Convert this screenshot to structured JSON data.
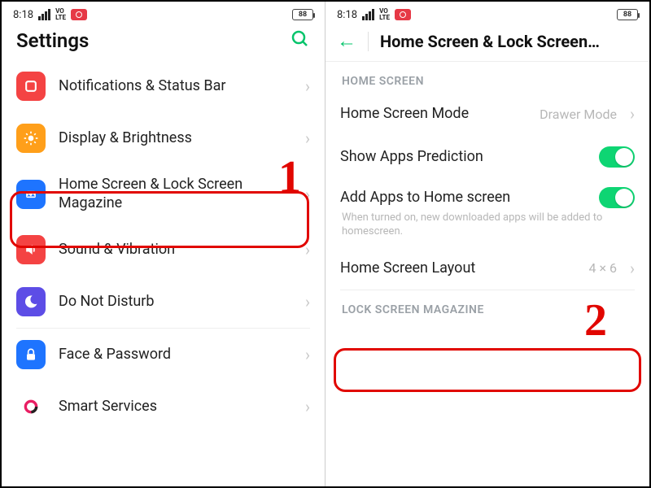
{
  "statusbar": {
    "time": "8:18",
    "volte": "VO\nLTE",
    "battery": "88"
  },
  "left": {
    "title": "Settings",
    "items": [
      {
        "label": "Notifications & Status Bar"
      },
      {
        "label": "Display & Brightness"
      },
      {
        "label": "Home Screen & Lock Screen Magazine"
      },
      {
        "label": "Sound & Vibration"
      },
      {
        "label": "Do Not Disturb"
      },
      {
        "label": "Face & Password"
      },
      {
        "label": "Smart Services"
      }
    ]
  },
  "right": {
    "title": "Home Screen & Lock Screen…",
    "section1": "HOME SCREEN",
    "mode": {
      "label": "Home Screen Mode",
      "value": "Drawer Mode"
    },
    "prediction": {
      "label": "Show Apps Prediction"
    },
    "addapps": {
      "label": "Add Apps to Home screen",
      "sub": "When turned on, new downloaded apps will be added to homescreen."
    },
    "layout": {
      "label": "Home Screen Layout",
      "value": "4 × 6"
    },
    "section2": "LOCK SCREEN MAGAZINE"
  },
  "annotations": {
    "one": "1",
    "two": "2"
  }
}
